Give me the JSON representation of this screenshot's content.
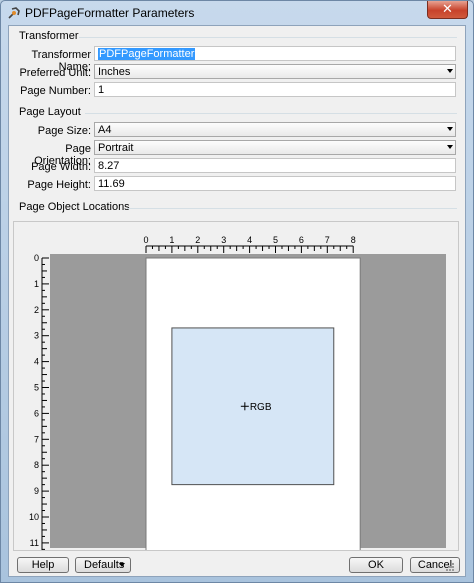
{
  "window": {
    "title": "PDFPageFormatter Parameters",
    "close_label": "✕"
  },
  "transformer": {
    "section_label": "Transformer",
    "name_label": "Transformer Name:",
    "name_value": "PDFPageFormatter",
    "unit_label": "Preferred Unit:",
    "unit_value": "Inches",
    "page_number_label": "Page Number:",
    "page_number_value": "1"
  },
  "page_layout": {
    "section_label": "Page Layout",
    "size_label": "Page Size:",
    "size_value": "A4",
    "orientation_label": "Page Orientation:",
    "orientation_value": "Portrait",
    "width_label": "Page Width:",
    "width_value": "8.27",
    "height_label": "Page Height:",
    "height_value": "11.69"
  },
  "locations": {
    "section_label": "Page Object Locations",
    "x_ticks": [
      "0",
      "1",
      "2",
      "3",
      "4",
      "5",
      "6",
      "7",
      "8"
    ],
    "y_ticks": [
      "0",
      "1",
      "2",
      "3",
      "4",
      "5",
      "6",
      "7",
      "8",
      "9",
      "10",
      "11"
    ],
    "page": {
      "width_in": 8.27,
      "height_in": 11.69
    },
    "object": {
      "label": "RGB",
      "x_in": [
        1.0,
        7.25
      ],
      "y_in": [
        2.7,
        8.75
      ],
      "fill": "#d6e6f6",
      "stroke": "#505050"
    },
    "canvas_bg": "#9b9b9b"
  },
  "buttons": {
    "help": "Help",
    "defaults": "Defaults",
    "ok": "OK",
    "cancel": "Cancel"
  }
}
